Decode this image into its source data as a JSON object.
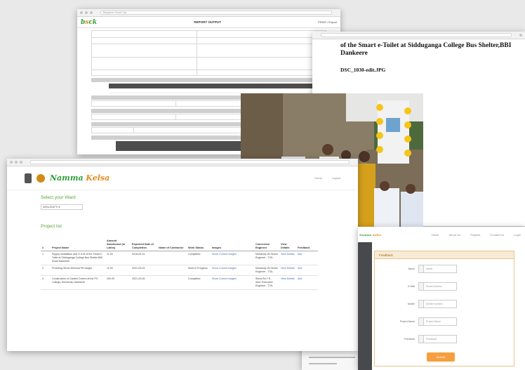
{
  "report": {
    "title": "REPORT OUTPUT",
    "tab_title": "Bangalore Smart City",
    "url": "",
    "print_label": "PRINT / Export"
  },
  "photo_window": {
    "url": "",
    "title_line1": "of the Smart e-Toilet at Sidduganga College Bus Shelter,BBI",
    "title_line2": "Dankeere",
    "filename": "DSC_1030-edit.JPG"
  },
  "projects": {
    "nav": [
      "Home",
      "Logout"
    ],
    "select_label": "Select your Ward",
    "select_value": "ARALIKATTI ▾",
    "list_title": "Project list",
    "headers": [
      "#",
      "Project Name",
      "Amount Sanctioned (in Lakhs)",
      "Expected Date of Completion",
      "Name of Contractor",
      "Work Status",
      "Images",
      "Concerned Engineer",
      "View Details",
      "Feedback"
    ],
    "rows": [
      [
        "1",
        "Supply Installation and O & M of the Smart e-Toilet at Sidduganga College Bus Shelter,BBI Road Dankeere",
        "11.00",
        "2018-03-31",
        "",
        "Completed",
        "Show Current Images",
        "Mohanraj LB Senior Engineer - TCIL",
        "View Details",
        "Add"
      ],
      [
        "2",
        "Providing Street Drinkout Pit vangal",
        "11.00",
        "2021-03-03",
        "",
        "Work in Progress",
        "Show Current Images",
        "Mohanraj LB Senior Engineer - TCIL",
        "View Details",
        "Add"
      ],
      [
        "3",
        "Construction of Garden Drivers at the PO College, Bennenal, Dankeere",
        "200.00",
        "2021-03-06",
        "",
        "Completed",
        "Show Current Images",
        "Shiva Ra T R - Asst. Executive Engineer - TCIL",
        "View Details",
        "Add"
      ]
    ]
  },
  "form": {
    "nav": [
      "Home",
      "About Us",
      "Projects",
      "Contact Us",
      "Login"
    ],
    "heading": "Feedback",
    "fields": [
      {
        "label": "Name",
        "placeholder": "Name"
      },
      {
        "label": "E-Mail",
        "placeholder": "Email Address"
      },
      {
        "label": "Mobile",
        "placeholder": "Mobile Number"
      },
      {
        "label": "Project Name",
        "placeholder": "Project Name"
      },
      {
        "label": "Feedback",
        "placeholder": "Feedback"
      }
    ],
    "submit": "Submit"
  },
  "colors": {
    "brand_green": "#5aa43a",
    "brand_orange": "#e58a1c",
    "button_orange": "#f5a03f"
  }
}
